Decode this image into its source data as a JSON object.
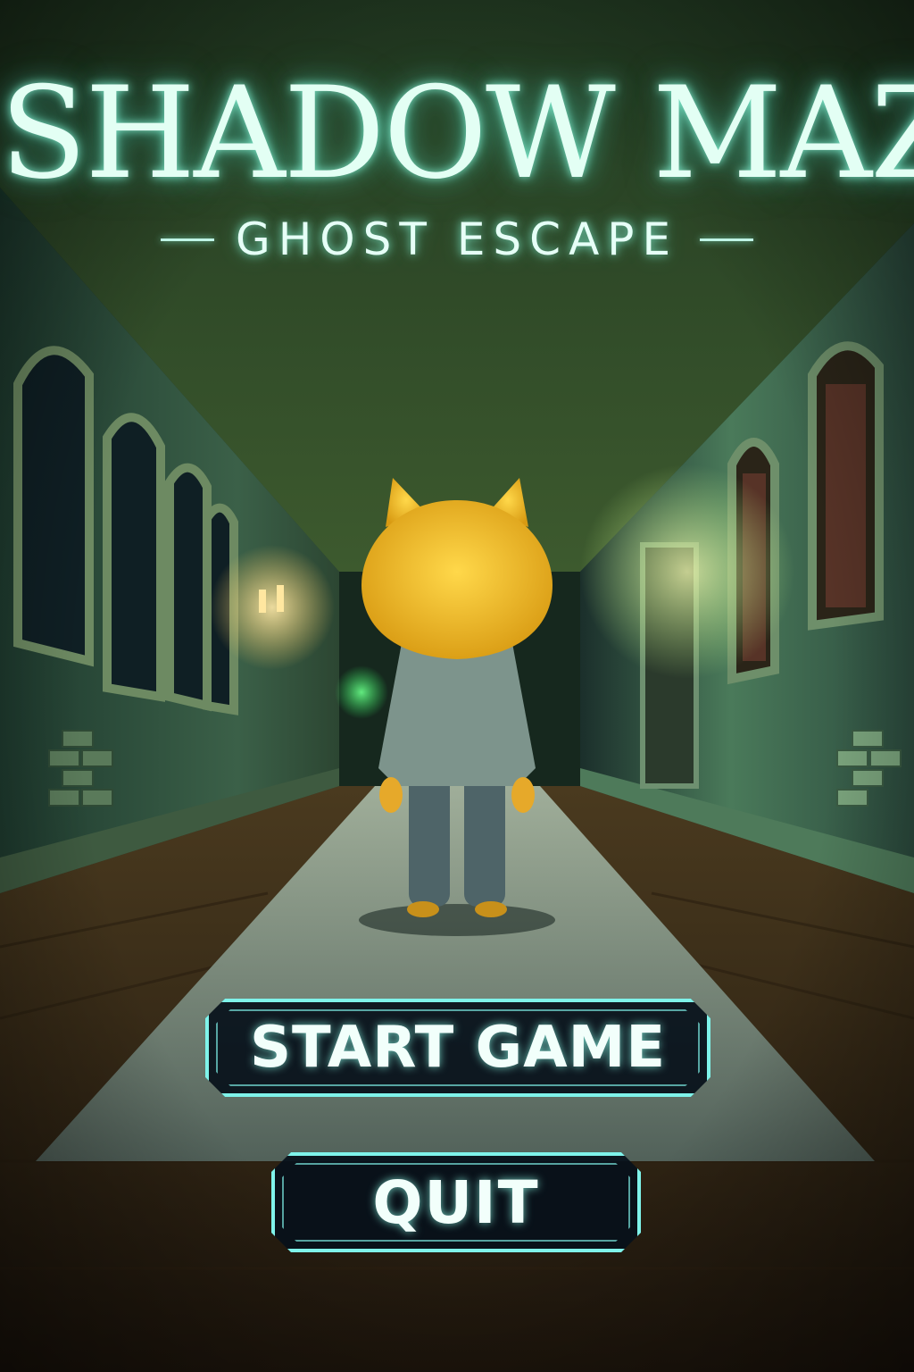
{
  "title": {
    "main": "SHADOW MAZE",
    "sub": "GHOST ESCAPE"
  },
  "menu": {
    "start_label": "START GAME",
    "quit_label": "QUIT"
  },
  "colors": {
    "title_glow": "#8cffe1",
    "button_border": "#7ff3ea",
    "button_fill": "#06101a",
    "character": "#f2b61e",
    "wall": "#2c4a36",
    "carpet": "#8fa39a",
    "floor": "#3a2b17"
  }
}
